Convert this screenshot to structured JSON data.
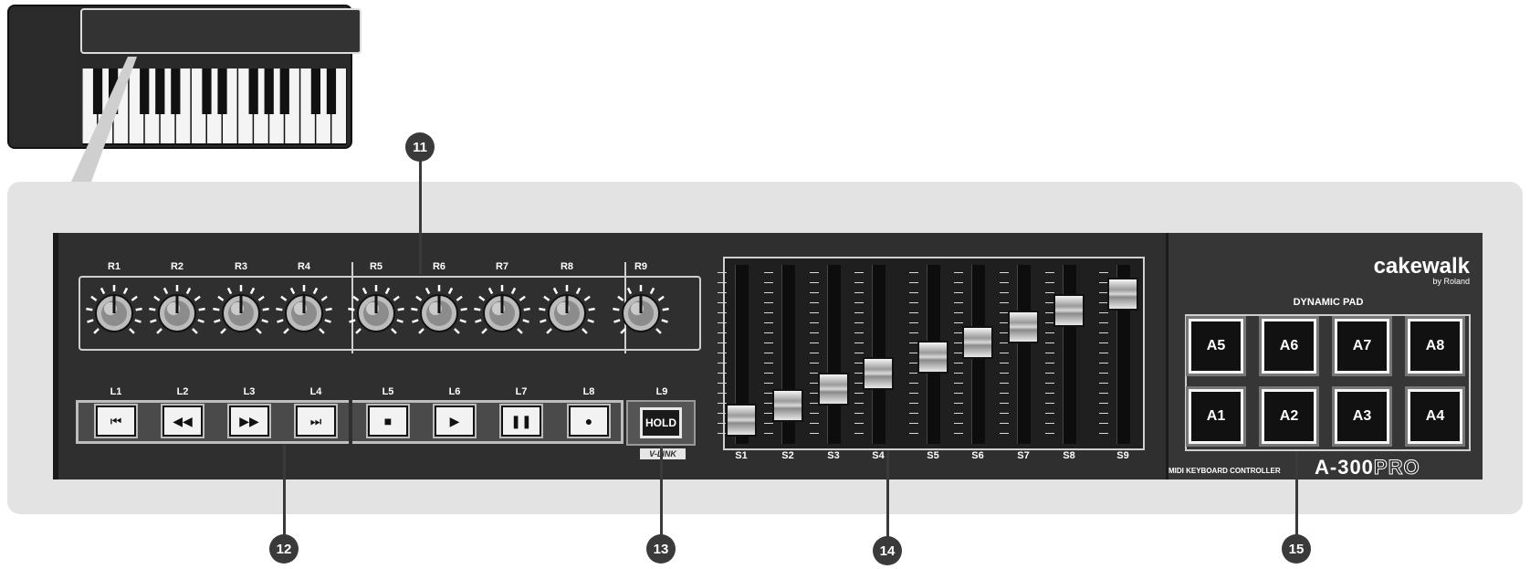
{
  "knobs": {
    "labels": [
      "R1",
      "R2",
      "R3",
      "R4",
      "R5",
      "R6",
      "R7",
      "R8",
      "R9"
    ]
  },
  "buttons": {
    "labels": [
      "L1",
      "L2",
      "L3",
      "L4",
      "L5",
      "L6",
      "L7",
      "L8",
      "L9"
    ],
    "icons": [
      "previous-icon",
      "rewind-icon",
      "fast-forward-icon",
      "next-icon",
      "stop-icon",
      "play-icon",
      "pause-icon",
      "record-icon"
    ],
    "glyphs": [
      "⏮",
      "◀◀",
      "▶▶",
      "⏭",
      "■",
      "▶",
      "❚❚",
      "●"
    ],
    "hold_label": "HOLD",
    "vlink_label": "V-LINK"
  },
  "faders": {
    "labels": [
      "S1",
      "S2",
      "S3",
      "S4",
      "S5",
      "S6",
      "S7",
      "S8",
      "S9"
    ],
    "levels": [
      0.05,
      0.15,
      0.26,
      0.37,
      0.48,
      0.58,
      0.69,
      0.8,
      0.91
    ]
  },
  "brand": {
    "name": "cakewalk",
    "sub": "by Roland"
  },
  "pads": {
    "title": "DYNAMIC PAD",
    "top_row": [
      "A5",
      "A6",
      "A7",
      "A8"
    ],
    "bottom_row": [
      "A1",
      "A2",
      "A3",
      "A4"
    ]
  },
  "model": {
    "caption": "MIDI KEYBOARD CONTROLLER",
    "name": "A-300",
    "suffix": "PRO"
  },
  "callouts": [
    "11",
    "12",
    "13",
    "14",
    "15"
  ]
}
